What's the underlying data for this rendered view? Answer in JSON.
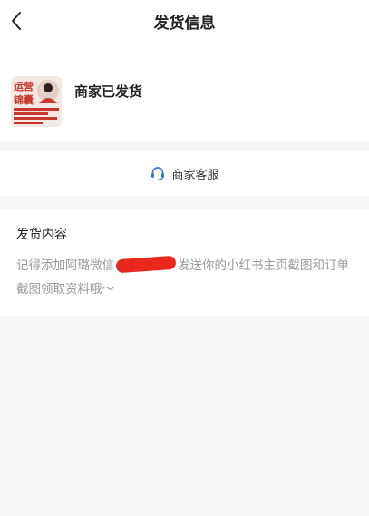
{
  "header": {
    "title": "发货信息",
    "back_icon": "chevron-left-icon"
  },
  "merchant": {
    "logo_text": "运营锦囊",
    "status": "商家已发货"
  },
  "service": {
    "icon": "headset-icon",
    "label": "商家客服",
    "accent_color": "#3a7bd5"
  },
  "shipment": {
    "heading": "发货内容",
    "body_before": "记得添加阿璐微信",
    "body_after": "发送你的小红书主页截图和订单截图领取资料哦～",
    "redaction_color": "#e8271d"
  }
}
